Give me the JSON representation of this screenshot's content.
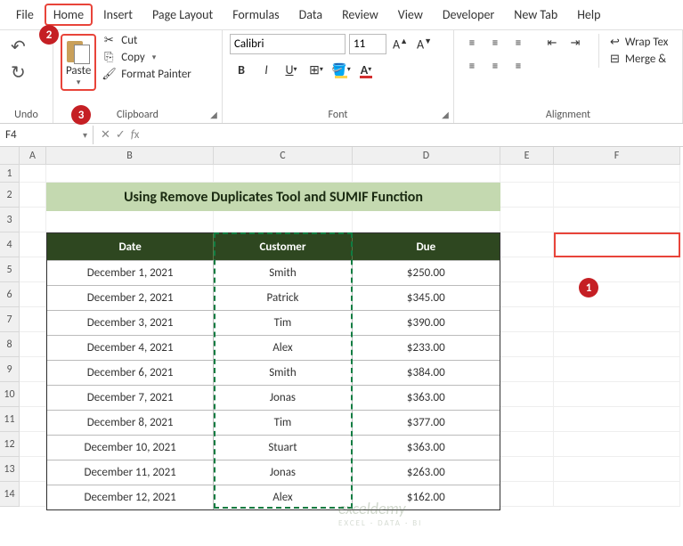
{
  "menu": [
    "File",
    "Home",
    "Insert",
    "Page Layout",
    "Formulas",
    "Data",
    "Review",
    "View",
    "Developer",
    "New Tab",
    "Help"
  ],
  "menu_active_index": 1,
  "ribbon": {
    "undo_group": "Undo",
    "clipboard_group": "Clipboard",
    "font_group": "Font",
    "align_group": "Alignment",
    "paste": "Paste",
    "cut": "Cut",
    "copy": "Copy",
    "format_painter": "Format Painter",
    "font_name": "Calibri",
    "font_size": "11",
    "wrap": "Wrap Tex",
    "merge": "Merge &"
  },
  "namebox": "F4",
  "cols": [
    "A",
    "B",
    "C",
    "D",
    "E",
    "F"
  ],
  "rows": [
    "1",
    "2",
    "3",
    "4",
    "5",
    "6",
    "7",
    "8",
    "9",
    "10",
    "11",
    "12",
    "13",
    "14"
  ],
  "title": "Using Remove Duplicates Tool and SUMIF Function",
  "table": {
    "headers": [
      "Date",
      "Customer",
      "Due"
    ],
    "rows": [
      [
        "December 1, 2021",
        "Smith",
        "$250.00"
      ],
      [
        "December 2, 2021",
        "Patrick",
        "$345.00"
      ],
      [
        "December 3, 2021",
        "Tim",
        "$390.00"
      ],
      [
        "December 4, 2021",
        "Alex",
        "$233.00"
      ],
      [
        "December 6, 2021",
        "Smith",
        "$384.00"
      ],
      [
        "December 7, 2021",
        "Jonas",
        "$363.00"
      ],
      [
        "December 8, 2021",
        "Tim",
        "$377.00"
      ],
      [
        "December 10, 2021",
        "Stuart",
        "$363.00"
      ],
      [
        "December 11, 2021",
        "Jonas",
        "$263.00"
      ],
      [
        "December 12, 2021",
        "Alex",
        "$162.00"
      ]
    ]
  },
  "callouts": {
    "c1": "1",
    "c2": "2",
    "c3": "3"
  },
  "watermark": {
    "brand": "exceldemy",
    "tag": "EXCEL · DATA · BI"
  }
}
